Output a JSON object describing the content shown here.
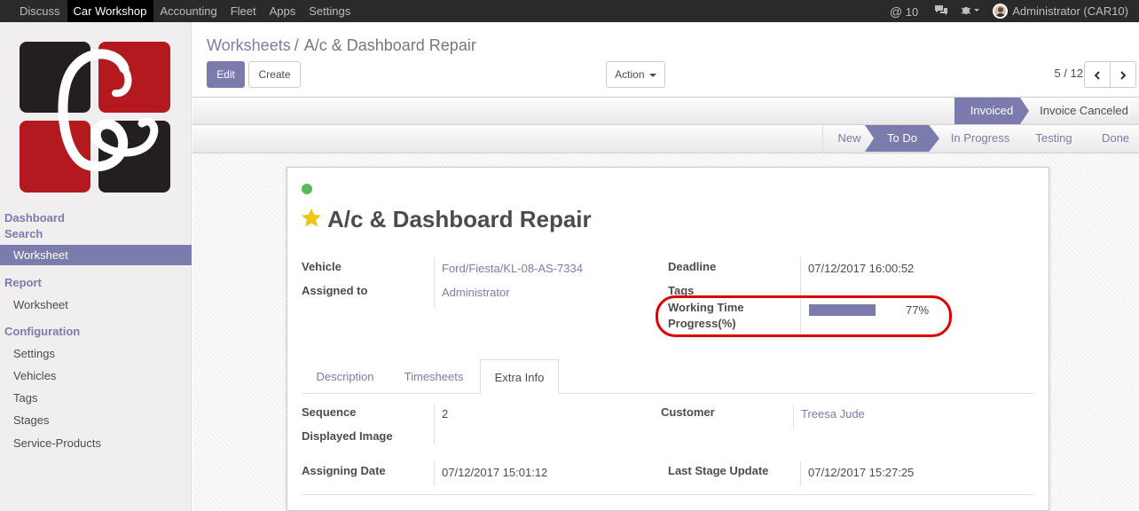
{
  "topbar": {
    "menu": [
      "Discuss",
      "Car Workshop",
      "Accounting",
      "Fleet",
      "Apps",
      "Settings"
    ],
    "active_menu": "Car Workshop",
    "messages_count": "10",
    "user": "Administrator (CAR10)"
  },
  "sidebar": {
    "sections": [
      {
        "title": "Dashboard",
        "items": []
      },
      {
        "title": "Search",
        "items": [
          "Worksheet"
        ]
      },
      {
        "title": "Report",
        "items": [
          "Worksheet"
        ]
      },
      {
        "title": "Configuration",
        "items": [
          "Settings",
          "Vehicles",
          "Tags",
          "Stages",
          "Service-Products"
        ]
      }
    ],
    "active_item": "Worksheet"
  },
  "breadcrumb": {
    "parent": "Worksheets",
    "separator": "/",
    "current": "A/c & Dashboard Repair"
  },
  "buttons": {
    "edit": "Edit",
    "create": "Create",
    "action": "Action"
  },
  "pager": {
    "text": "5 / 12"
  },
  "invoice_status": [
    "Invoiced",
    "Invoice Canceled"
  ],
  "invoice_active": "Invoiced",
  "stages": [
    "New",
    "To Do",
    "In Progress",
    "Testing",
    "Done"
  ],
  "stage_active": "To Do",
  "record": {
    "title": "A/c & Dashboard Repair",
    "status_color": "#5cb85c",
    "starred": true,
    "fields": {
      "vehicle_label": "Vehicle",
      "vehicle": "Ford/Fiesta/KL-08-AS-7334",
      "assigned_label": "Assigned to",
      "assigned": "Administrator",
      "deadline_label": "Deadline",
      "deadline": "07/12/2017 16:00:52",
      "tags_label": "Tags",
      "progress_label_1": "Working Time",
      "progress_label_2": "Progress(%)",
      "progress_value": 77,
      "progress_text": "77%"
    }
  },
  "tabs": [
    "Description",
    "Timesheets",
    "Extra Info"
  ],
  "active_tab": "Extra Info",
  "extra_info": {
    "sequence_label": "Sequence",
    "sequence": "2",
    "displayed_image_label": "Displayed Image",
    "customer_label": "Customer",
    "customer": "Treesa Jude",
    "assigning_date_label": "Assigning Date",
    "assigning_date": "07/12/2017 15:01:12",
    "last_stage_label": "Last Stage Update",
    "last_stage": "07/12/2017 15:27:25"
  },
  "colors": {
    "accent": "#7c7bad",
    "highlight": "#e00000",
    "topbar": "#2a2a2a",
    "star": "#f0c419"
  }
}
